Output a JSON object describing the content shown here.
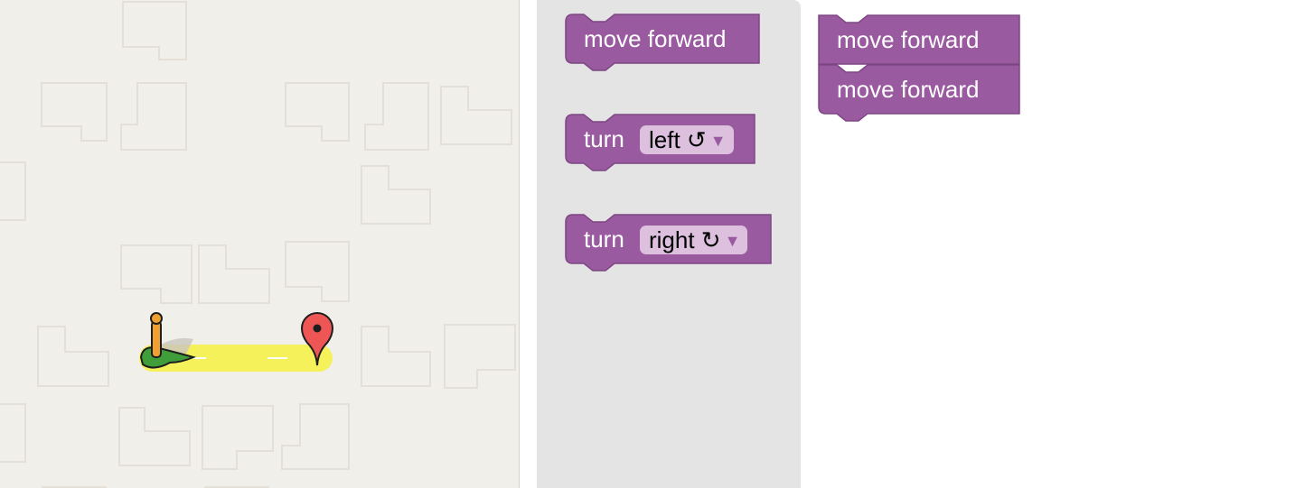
{
  "colors": {
    "maze_background": "#f1efe9",
    "path": "#f5f15a",
    "block": "#9a5aa0",
    "toolbox": "#e4e4e4",
    "goal_marker": "#ee5656",
    "pegman_base": "#3f9e3a"
  },
  "maze": {
    "start_icon": "pegman-start-icon",
    "goal_icon": "map-marker-icon"
  },
  "toolbox": {
    "move_forward_label": "move forward",
    "turn_left": {
      "label": "turn",
      "value": "left ↺"
    },
    "turn_right": {
      "label": "turn",
      "value": "right ↻"
    },
    "dropdown_icon": "triangle-down-icon"
  },
  "workspace": {
    "blocks": [
      {
        "label": "move forward"
      },
      {
        "label": "move forward"
      }
    ]
  }
}
